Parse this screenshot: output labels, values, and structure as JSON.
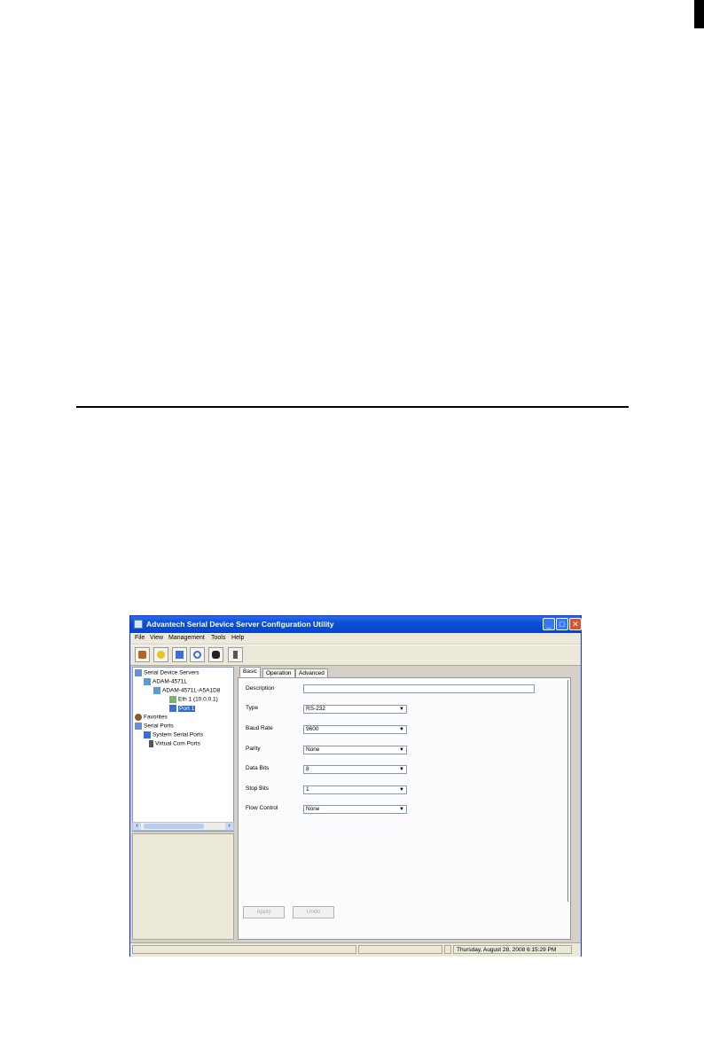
{
  "window": {
    "title": "Advantech Serial Device Server Configuration Utility"
  },
  "menu": [
    "File",
    "View",
    "Management",
    "Tools",
    "Help"
  ],
  "toolbar": [
    "add-server-icon",
    "search-icon",
    "refresh-icon",
    "find-icon",
    "locate-icon",
    "port-icon"
  ],
  "tree": {
    "root": "Serial Device Servers",
    "server_group": "ADAM-4571L",
    "server": "ADAM-4571L-A5A1D8",
    "eth": "Eth 1 (10.0.0.1)",
    "port": "Port 1",
    "favorites": "Favorites",
    "serial_ports": "Serial Ports",
    "system_serial_ports": "System Serial Ports",
    "virtual_com_ports": "Virtual Com Ports"
  },
  "tabs": [
    "Basic",
    "Operation",
    "Advanced"
  ],
  "form": {
    "description": {
      "label": "Description",
      "value": ""
    },
    "type": {
      "label": "Type",
      "value": "RS-232"
    },
    "baud_rate": {
      "label": "Baud Rate",
      "value": "9600"
    },
    "parity": {
      "label": "Parity",
      "value": "None"
    },
    "data_bits": {
      "label": "Data Bits",
      "value": "8"
    },
    "stop_bits": {
      "label": "Stop Bits",
      "value": "1"
    },
    "flow_control": {
      "label": "Flow Control",
      "value": "None"
    }
  },
  "buttons": {
    "apply": "Apply",
    "undo": "Undo"
  },
  "status": {
    "datetime": "Thursday, August 28, 2008 6:15:29 PM"
  },
  "colors": {
    "titlebar": "#0a4fd6",
    "selection": "#316ac5"
  }
}
